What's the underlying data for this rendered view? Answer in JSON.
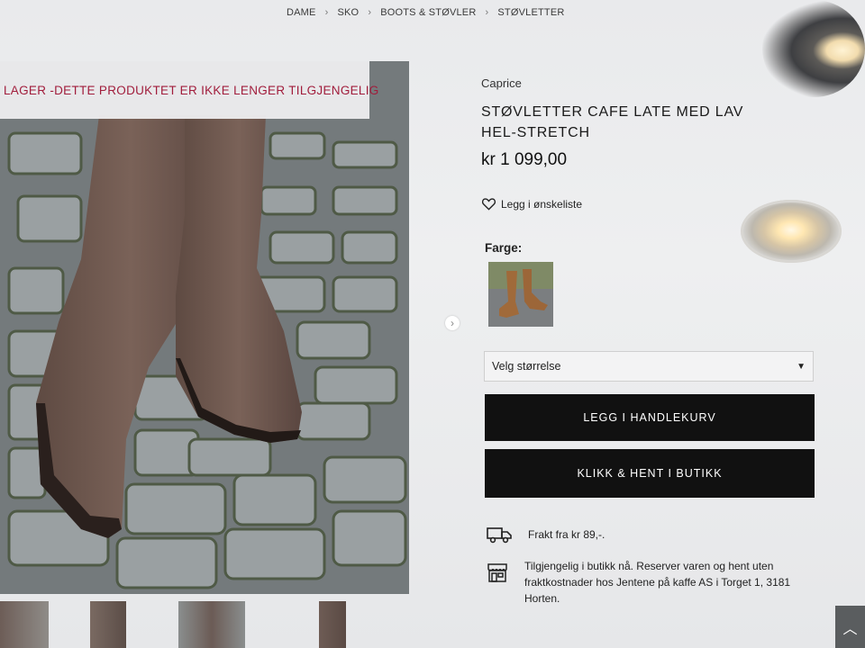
{
  "breadcrumb": [
    "DAME",
    "SKO",
    "BOOTS & STØVLER",
    "STØVLETTER"
  ],
  "banner": {
    "text": "LAGER -DETTE PRODUKTET ER IKKE LENGER TILGJENGELIG"
  },
  "product": {
    "brand": "Caprice",
    "title": "STØVLETTER CAFE LATE MED LAV HEL-STRETCH",
    "price": "kr 1 099,00",
    "wishlist_label": "Legg i ønskeliste",
    "color_label": "Farge:",
    "size_select": {
      "value": "Velg størrelse"
    },
    "add_to_cart_label": "LEGG I HANDLEKURV",
    "click_collect_label": "KLIKK & HENT I BUTIKK",
    "shipping_text": "Frakt fra kr 89,-.",
    "store_text": "Tilgjengelig i butikk nå. Reserver varen og hent uten fraktkostnader hos Jentene på kaffe AS i Torget 1, 3181 Horten."
  },
  "icons": {
    "breadcrumb_sep": "chevron-right-icon",
    "wishlist": "heart-icon",
    "select": "caret-down-icon",
    "shipping": "truck-icon",
    "store": "store-icon",
    "gallery_next": "chevron-right-icon",
    "back_to_top": "chevron-up-icon"
  },
  "colors": {
    "banner_text": "#a11d3c",
    "button_bg": "#111111",
    "button_text": "#ffffff"
  }
}
